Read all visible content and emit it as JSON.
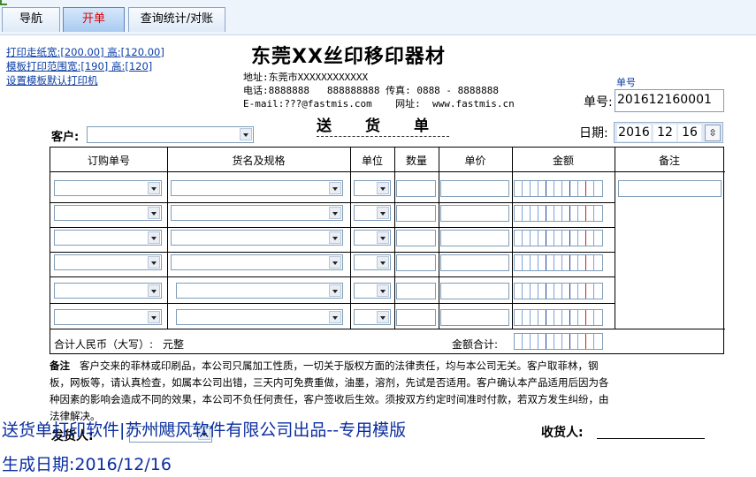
{
  "tabs": [
    {
      "label": "导航"
    },
    {
      "label": "开单"
    },
    {
      "label": "查询统计/对账"
    }
  ],
  "links": {
    "paper_size": "打印走纸宽:[200.00] 高:[120.00]",
    "print_range": "模板打印范围宽:[190] 高:[120]",
    "default_printer": "设置模板默认打印机"
  },
  "company": {
    "name": "东莞XX丝印移印器材",
    "address": "地址:东莞市XXXXXXXXXXXX",
    "phone": "电话:8888888   888888888 传真: 0888 - 8888888",
    "email": "E-mail:???@fastmis.com    网址:  www.fastmis.cn"
  },
  "doc_title": "送货单",
  "order_no": {
    "small_label": "单号",
    "label": "单号:",
    "value": "201612160001"
  },
  "date": {
    "label": "日期:",
    "year": "2016",
    "month": "12",
    "day": "16",
    "spin": "⇳"
  },
  "customer": {
    "label": "客户:",
    "value": ""
  },
  "table": {
    "headers": [
      "订购单号",
      "货名及规格",
      "单位",
      "数量",
      "单价",
      "金额",
      "备注"
    ],
    "total_cn_label": "合计人民币（大写）:",
    "total_cn_value": "元整",
    "total_amount_label": "金额合计:"
  },
  "note": {
    "label": "备注",
    "text": "客户交来的菲林或印刷品，本公司只属加工性质，一切关于版权方面的法律责任，均与本公司无关。客户取菲林，钢板，网板等，请认真检查，如属本公司出错，三天内可免费重做，油墨，溶剂，先试是否适用。客户确认本产品适用后因为各种因素的影响会造成不同的效果，本公司不负任何责任，客户签收后生效。须按双方约定时间准时付款，若双方发生纠纷，由法律解决。"
  },
  "shipper_label": "发货人:",
  "receiver_label": "收货人:",
  "footer": {
    "line1": "送货单打印软件|苏州飓风软件有限公司出品--专用模版",
    "line2": "生成日期:2016/12/16"
  },
  "colors": {
    "tab_active_text": "#e00000",
    "link": "#0b3da4",
    "footer_text": "#0b2ea0"
  }
}
